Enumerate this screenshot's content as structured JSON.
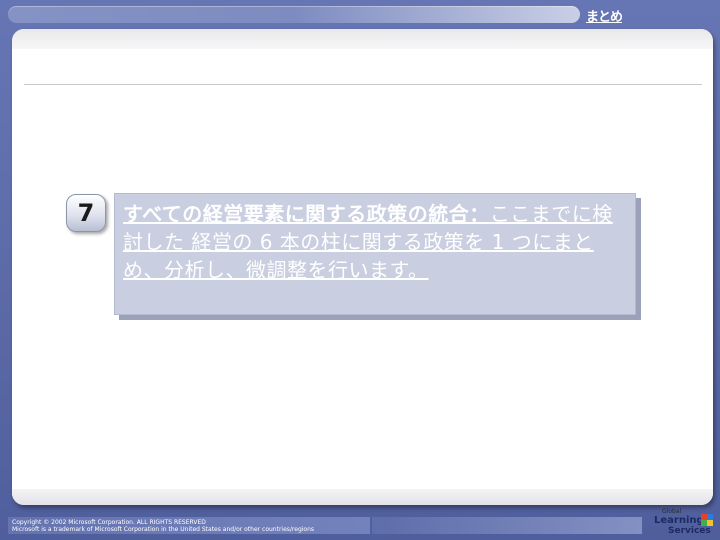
{
  "header": {
    "summary_link": "まとめ"
  },
  "step": {
    "number": "7"
  },
  "callout": {
    "lead": "すべての経営要素に関する政策の統合：",
    "body": "ここまでに検討した 経営の 6 本の柱に関する政策を 1 つにまとめ、分析し、微調整を行います。"
  },
  "footer": {
    "copyright_line1": "Copyright © 2002 Microsoft Corporation. ALL RIGHTS RESERVED",
    "copyright_line2": "Microsoft is a trademark of Microsoft Corporation in the United States and/or other countries/regions"
  },
  "logo": {
    "line1": "Global",
    "line2": "Learning",
    "line3": "Services"
  },
  "colors": {
    "background": "#5a6aa8",
    "callout": "#c9cfe0",
    "callout_text": "#ffffff"
  },
  "icons": {
    "logo_mark": "checkered-flag-icon"
  }
}
